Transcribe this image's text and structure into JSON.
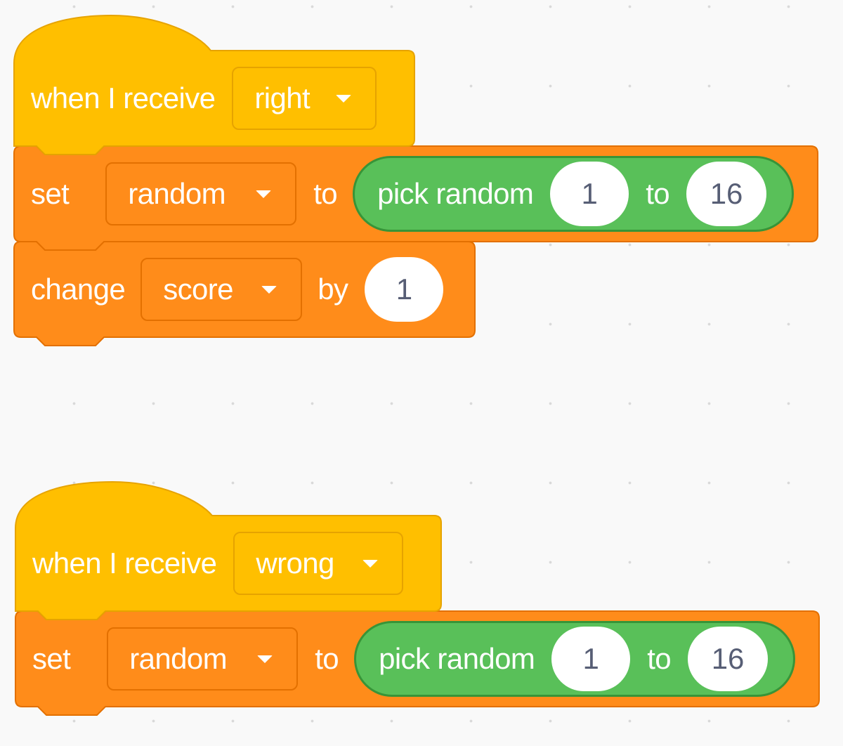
{
  "workspace": {
    "scripts": [
      {
        "hat": {
          "text": "when I receive",
          "message": "right"
        },
        "set_block": {
          "set_label": "set",
          "variable": "random",
          "to_label": "to",
          "reporter": {
            "label": "pick random",
            "from": "1",
            "to_label": "to",
            "to": "16"
          }
        },
        "change_block": {
          "change_label": "change",
          "variable": "score",
          "by_label": "by",
          "value": "1"
        }
      },
      {
        "hat": {
          "text": "when I receive",
          "message": "wrong"
        },
        "set_block": {
          "set_label": "set",
          "variable": "random",
          "to_label": "to",
          "reporter": {
            "label": "pick random",
            "from": "1",
            "to_label": "to",
            "to": "16"
          }
        }
      }
    ]
  },
  "colors": {
    "events": "#ffbf00",
    "events_border": "#e6a300",
    "variables": "#ff8c1a",
    "variables_border": "#e37000",
    "operators": "#59c059",
    "operators_border": "#389438",
    "workspace_bg": "#f9f9f9",
    "number_text": "#575e75"
  }
}
